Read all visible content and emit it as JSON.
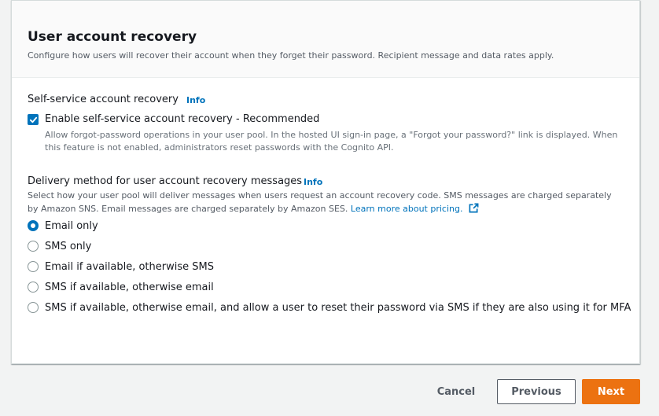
{
  "header": {
    "title": "User account recovery",
    "description": "Configure how users will recover their account when they forget their password. Recipient message and data rates apply."
  },
  "self_service": {
    "label": "Self-service account recovery",
    "info": "Info",
    "checkbox_label": "Enable self-service account recovery - Recommended",
    "checkbox_checked": true,
    "checkbox_description": "Allow forgot-password operations in your user pool. In the hosted UI sign-in page, a \"Forgot your password?\" link is displayed. When this feature is not enabled, administrators reset passwords with the Cognito API."
  },
  "delivery": {
    "label": "Delivery method for user account recovery messages",
    "info": "Info",
    "description": "Select how your user pool will deliver messages when users request an account recovery code. SMS messages are charged separately by Amazon SNS. Email messages are charged separately by Amazon SES.",
    "link": "Learn more about pricing.",
    "options": [
      {
        "label": "Email only",
        "selected": true
      },
      {
        "label": "SMS only",
        "selected": false
      },
      {
        "label": "Email if available, otherwise SMS",
        "selected": false
      },
      {
        "label": "SMS if available, otherwise email",
        "selected": false
      },
      {
        "label": "SMS if available, otherwise email, and allow a user to reset their password via SMS if they are also using it for MFA",
        "selected": false
      }
    ]
  },
  "footer": {
    "cancel": "Cancel",
    "previous": "Previous",
    "next": "Next"
  },
  "colors": {
    "accent": "#0073bb",
    "primary_button": "#ec7211"
  }
}
